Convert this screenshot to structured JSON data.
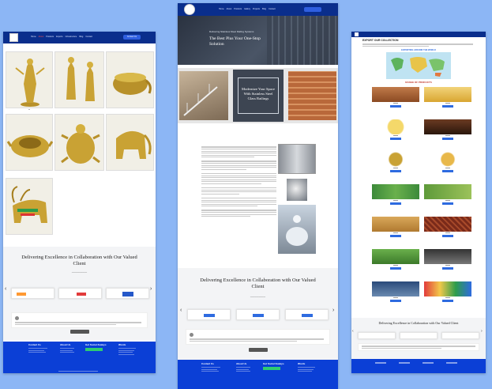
{
  "page1": {
    "nav_items": [
      "Home",
      "About",
      "Products",
      "Exports",
      "Infrastructure",
      "Blog",
      "Contact"
    ],
    "contact_btn": "Contact Us",
    "section_title": "Delivering Excellence in Collaboration with Our Valued Client",
    "footer_cols": [
      "Contact Us",
      "About Us",
      "Get Social Zealeys",
      "Words"
    ]
  },
  "page2": {
    "nav_items": [
      "Home",
      "About",
      "Products",
      "Gallery",
      "Projects",
      "Blog",
      "Contact"
    ],
    "hero_small": "Delivering Stainless Steel Railing Systems",
    "hero_title": "The Best Plus Your One-Stop Solution",
    "center_text": "Modernize Your Space With Stainless Steel Glass Railings",
    "section_title": "Delivering Excellence in Collaboration with Our Valued Client",
    "footer_cols": [
      "Contact Us",
      "About Us",
      "Get Social Zealeys",
      "Words"
    ]
  },
  "page3": {
    "heading": "EXPORT OUR COLLECTION",
    "map_title": "EXPORTING AROUND THE WORLD",
    "range_title": "RANGE OF PRODUCTS",
    "section_title": "Delivering Excellence in Collaboration with Our Valued Client"
  },
  "colors": {
    "background": "#8cb6f5",
    "nav": "#0a2e8c",
    "footer": "#0b3fd6",
    "accent": "#2f5fe0"
  }
}
